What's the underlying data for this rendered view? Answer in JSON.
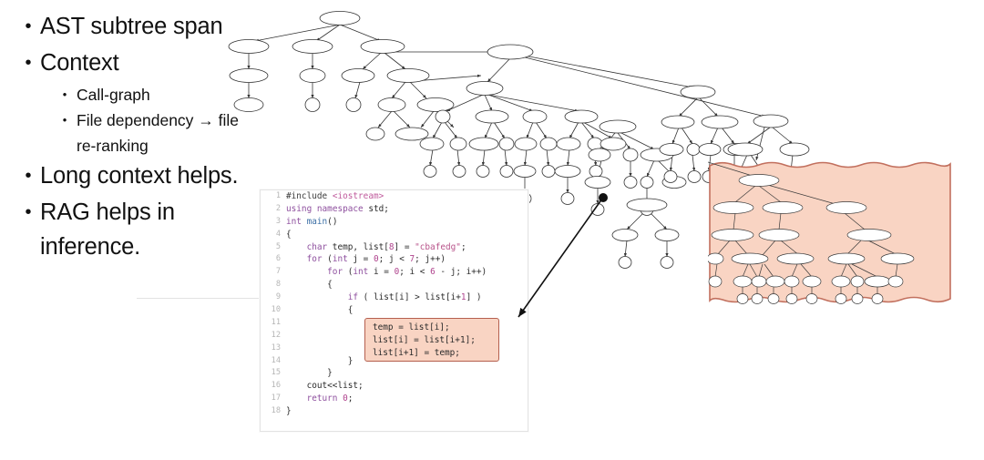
{
  "slide": {
    "background_color": "#ffffff",
    "bullets": [
      {
        "level": 1,
        "marker": "•",
        "text": "AST subtree span"
      },
      {
        "level": 1,
        "marker": "•",
        "text": "Context"
      },
      {
        "level": 2,
        "marker": "•",
        "text": "Call-graph"
      },
      {
        "level": 2,
        "marker": "•",
        "text": "File dependency → file re-ranking"
      },
      {
        "level": 1,
        "marker": "•",
        "text": "Long context helps."
      },
      {
        "level": 1,
        "marker": "•",
        "text": "RAG helps in inference."
      }
    ]
  },
  "code_panel": {
    "language": "C++",
    "lines": [
      {
        "n": "1",
        "text": "#include <iostream>"
      },
      {
        "n": "2",
        "text": "using namespace std;"
      },
      {
        "n": "3",
        "text": "int main()"
      },
      {
        "n": "4",
        "text": "{"
      },
      {
        "n": "5",
        "text": "    char temp, list[8] = \"cbafedg\";"
      },
      {
        "n": "6",
        "text": "    for (int j = 0; j < 7; j++)"
      },
      {
        "n": "7",
        "text": "        for (int i = 0; i < 6 - j; i++)"
      },
      {
        "n": "8",
        "text": "        {"
      },
      {
        "n": "9",
        "text": "            if ( list[i] > list[i+1] )"
      },
      {
        "n": "10",
        "text": "            {"
      },
      {
        "n": "11",
        "text": "                temp = list[i];"
      },
      {
        "n": "12",
        "text": "                list[i] = list[i+1];"
      },
      {
        "n": "13",
        "text": "                list[i+1] = temp;"
      },
      {
        "n": "14",
        "text": "            }"
      },
      {
        "n": "15",
        "text": "        }"
      },
      {
        "n": "16",
        "text": "    cout<<list;"
      },
      {
        "n": "17",
        "text": "    return 0;"
      },
      {
        "n": "18",
        "text": "}"
      }
    ]
  },
  "code_highlight": {
    "fill_color": "#f9d4c3",
    "border_color": "#b5604f",
    "lines": [
      "temp = list[i];",
      "list[i] = list[i+1];",
      "list[i+1] = temp;"
    ]
  },
  "subtree_highlight": {
    "fill_color": "#f9d4c3",
    "border_color": "#c2705e",
    "label": "highlighted AST subtree span"
  },
  "connector": {
    "style": "arrow",
    "color": "#111111",
    "from": "ast-node-dot",
    "to": "code-highlight"
  },
  "ast": {
    "node_fill": "#ffffff",
    "node_stroke": "#333333",
    "edge_color": "#333333",
    "description": "abstract syntax tree of the C++ bubble-sort program"
  }
}
